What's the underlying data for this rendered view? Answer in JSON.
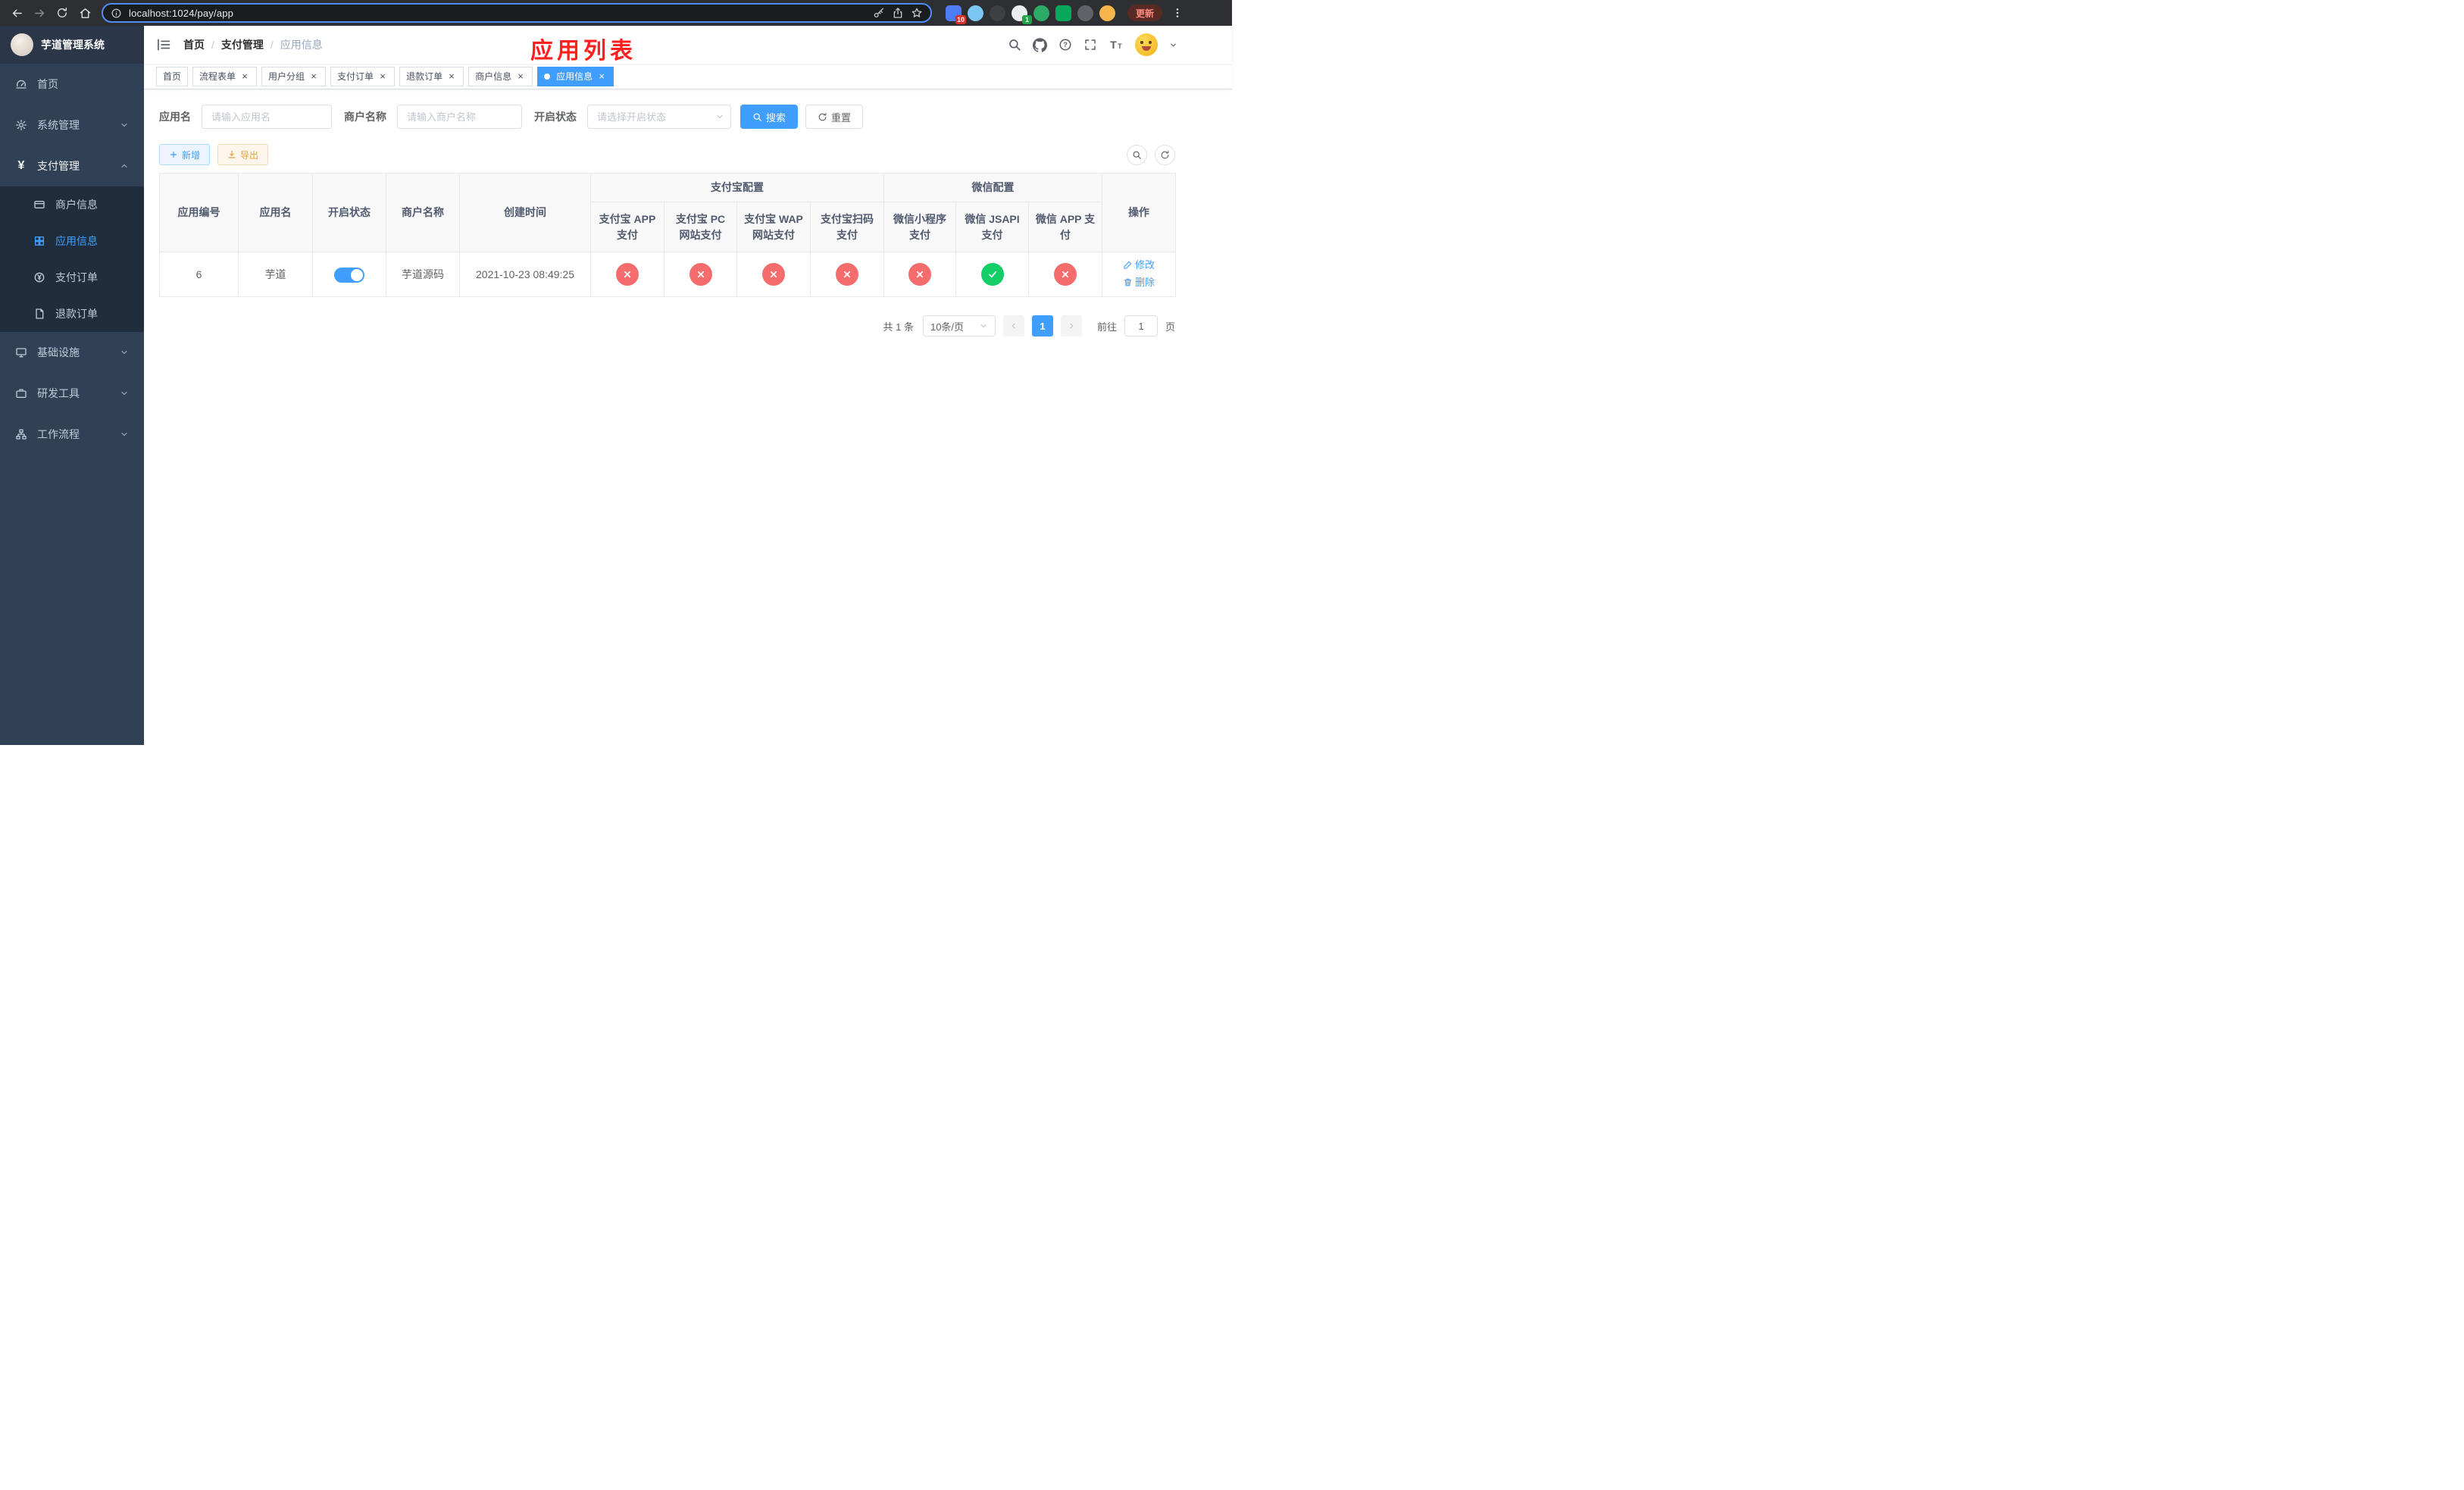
{
  "browser": {
    "url": "localhost:1024/pay/app",
    "update_label": "更新",
    "extension_badges": [
      "10",
      "1"
    ]
  },
  "icons": {
    "yen": "¥",
    "close": "×",
    "breadcrumb_sep": "/"
  },
  "sidebar": {
    "title": "芋道管理系统",
    "items": [
      {
        "label": "首页"
      },
      {
        "label": "系统管理"
      },
      {
        "label": "支付管理",
        "children": [
          {
            "label": "商户信息"
          },
          {
            "label": "应用信息"
          },
          {
            "label": "支付订单"
          },
          {
            "label": "退款订单"
          }
        ]
      },
      {
        "label": "基础设施"
      },
      {
        "label": "研发工具"
      },
      {
        "label": "工作流程"
      }
    ]
  },
  "header": {
    "breadcrumb": [
      "首页",
      "支付管理",
      "应用信息"
    ],
    "page_title": "应用列表"
  },
  "tabs": [
    {
      "label": "首页"
    },
    {
      "label": "流程表单"
    },
    {
      "label": "用户分组"
    },
    {
      "label": "支付订单"
    },
    {
      "label": "退款订单"
    },
    {
      "label": "商户信息"
    },
    {
      "label": "应用信息"
    }
  ],
  "search_form": {
    "app_name_label": "应用名",
    "app_name_placeholder": "请输入应用名",
    "merchant_label": "商户名称",
    "merchant_placeholder": "请输入商户名称",
    "status_label": "开启状态",
    "status_placeholder": "请选择开启状态",
    "search_label": "搜索",
    "reset_label": "重置"
  },
  "toolbar": {
    "add_label": "新增",
    "export_label": "导出"
  },
  "table": {
    "columns": [
      "应用编号",
      "应用名",
      "开启状态",
      "商户名称",
      "创建时间"
    ],
    "group_alipay": "支付宝配置",
    "group_wechat": "微信配置",
    "alipay_columns": [
      "支付宝 APP 支付",
      "支付宝 PC 网站支付",
      "支付宝 WAP 网站支付",
      "支付宝扫码支付"
    ],
    "wechat_columns": [
      "微信小程序支付",
      "微信 JSAPI 支付",
      "微信 APP 支付"
    ],
    "actions_column": "操作",
    "rows": [
      {
        "id": "6",
        "name": "芋道",
        "status": true,
        "merchant": "芋道源码",
        "created": "2021-10-23 08:49:25",
        "alipay": [
          false,
          false,
          false,
          false
        ],
        "wechat": [
          false,
          true,
          false
        ],
        "edit_label": "修改",
        "delete_label": "删除"
      }
    ]
  },
  "pagination": {
    "total": "共 1 条",
    "page_size": "10条/页",
    "current_page": "1",
    "goto_label": "前往",
    "goto_value": "1",
    "goto_suffix": "页"
  }
}
